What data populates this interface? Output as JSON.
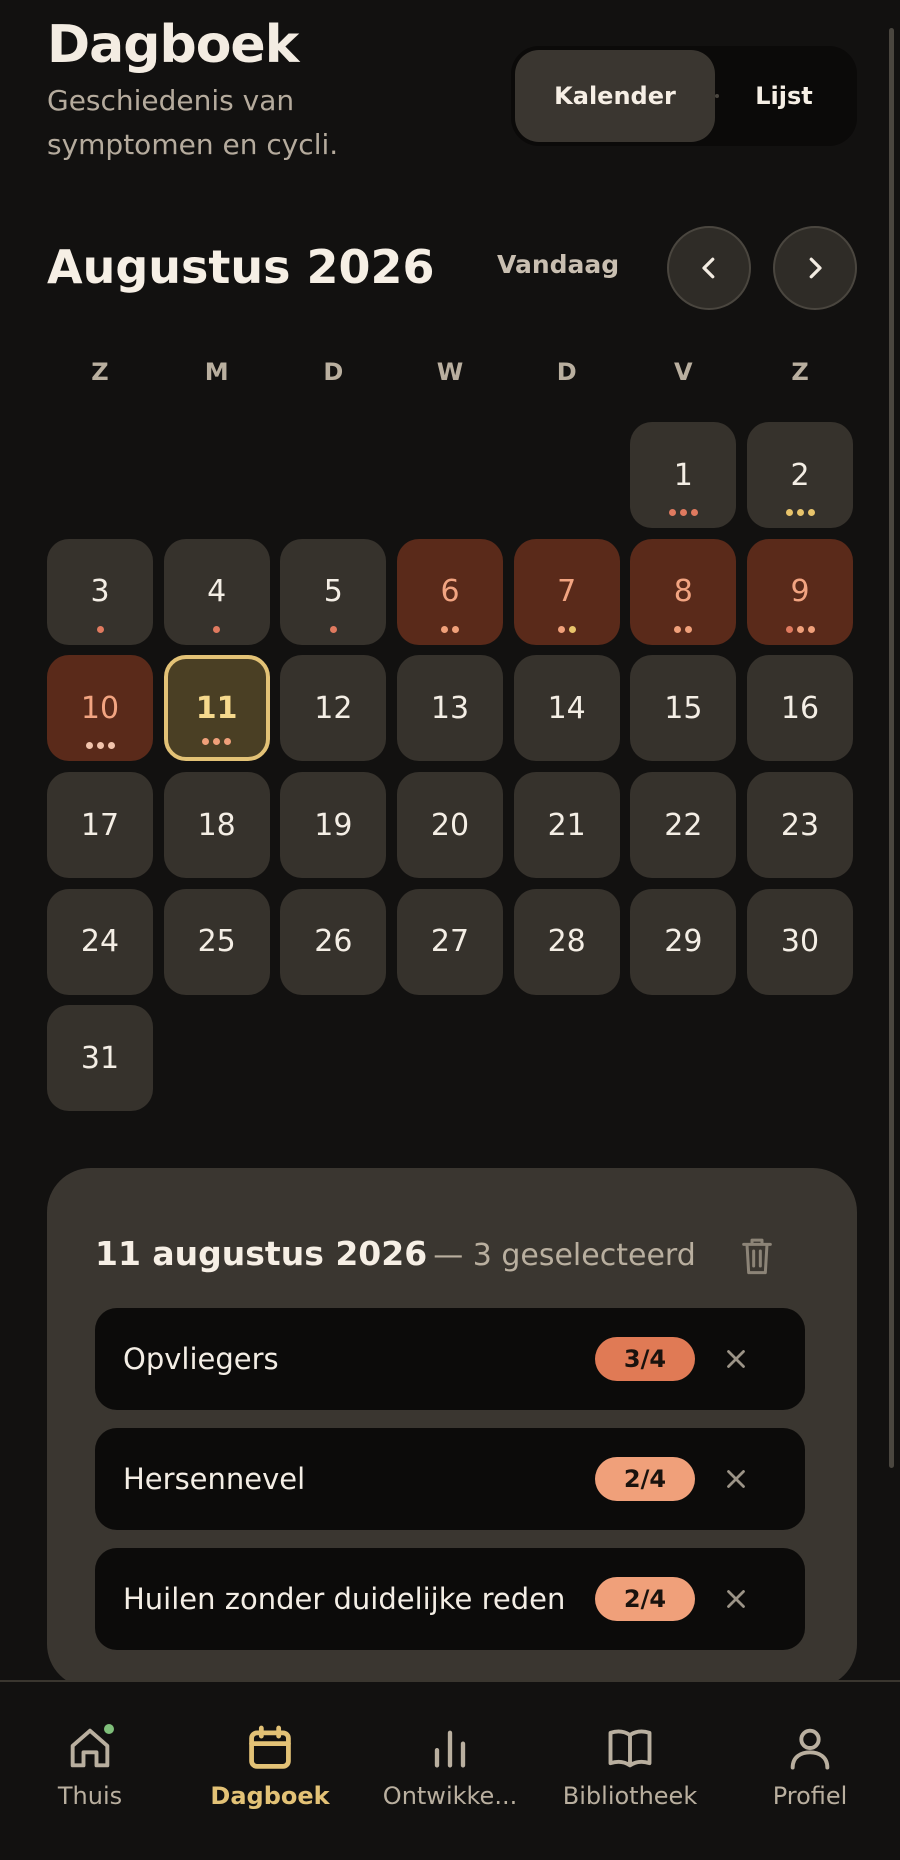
{
  "header": {
    "title": "Dagboek",
    "subtitle": "Geschiedenis van symptomen en cycli.",
    "view_toggle": {
      "calendar": "Kalender",
      "list": "Lijst",
      "active": "calendar"
    }
  },
  "calendar": {
    "month_title": "Augustus 2026",
    "today_label": "Vandaag",
    "weekdays": [
      "Z",
      "M",
      "D",
      "W",
      "D",
      "V",
      "Z"
    ],
    "first_weekday_index": 5,
    "days": [
      {
        "day": 1,
        "type": "normal",
        "dots": [
          "#e07a5f",
          "#e07a5f",
          "#e07a5f"
        ]
      },
      {
        "day": 2,
        "type": "normal",
        "dots": [
          "#e8c46b",
          "#e8c46b",
          "#e8c46b"
        ]
      },
      {
        "day": 3,
        "type": "normal",
        "dots": [
          "#e07a5f"
        ]
      },
      {
        "day": 4,
        "type": "normal",
        "dots": [
          "#e07a5f"
        ]
      },
      {
        "day": 5,
        "type": "normal",
        "dots": [
          "#e07a5f"
        ]
      },
      {
        "day": 6,
        "type": "period",
        "dots": [
          "#f0a07a",
          "#f0a07a"
        ]
      },
      {
        "day": 7,
        "type": "period",
        "dots": [
          "#f0a07a",
          "#e8c46b"
        ]
      },
      {
        "day": 8,
        "type": "period",
        "dots": [
          "#f0a07a",
          "#f0a07a"
        ]
      },
      {
        "day": 9,
        "type": "period",
        "dots": [
          "#e07a5f",
          "#f0a07a",
          "#f0a07a"
        ]
      },
      {
        "day": 10,
        "type": "period",
        "dots": [
          "#f2c4ad",
          "#f2c4ad",
          "#f2c4ad"
        ]
      },
      {
        "day": 11,
        "type": "selected",
        "dots": [
          "#f0a07a",
          "#f0a07a",
          "#f0a07a"
        ]
      },
      {
        "day": 12,
        "type": "normal",
        "dots": []
      },
      {
        "day": 13,
        "type": "normal",
        "dots": []
      },
      {
        "day": 14,
        "type": "normal",
        "dots": []
      },
      {
        "day": 15,
        "type": "normal",
        "dots": []
      },
      {
        "day": 16,
        "type": "normal",
        "dots": []
      },
      {
        "day": 17,
        "type": "normal",
        "dots": []
      },
      {
        "day": 18,
        "type": "normal",
        "dots": []
      },
      {
        "day": 19,
        "type": "normal",
        "dots": []
      },
      {
        "day": 20,
        "type": "normal",
        "dots": []
      },
      {
        "day": 21,
        "type": "normal",
        "dots": []
      },
      {
        "day": 22,
        "type": "normal",
        "dots": []
      },
      {
        "day": 23,
        "type": "normal",
        "dots": []
      },
      {
        "day": 24,
        "type": "normal",
        "dots": []
      },
      {
        "day": 25,
        "type": "normal",
        "dots": []
      },
      {
        "day": 26,
        "type": "normal",
        "dots": []
      },
      {
        "day": 27,
        "type": "normal",
        "dots": []
      },
      {
        "day": 28,
        "type": "normal",
        "dots": []
      },
      {
        "day": 29,
        "type": "normal",
        "dots": []
      },
      {
        "day": 30,
        "type": "normal",
        "dots": []
      },
      {
        "day": 31,
        "type": "normal",
        "dots": []
      }
    ]
  },
  "selected_day": {
    "date": "11 augustus 2026",
    "count_text": "— 3 geselecteerd",
    "symptoms": [
      {
        "name": "Opvliegers",
        "severity": "3/4",
        "color": "#e07a55"
      },
      {
        "name": "Hersennevel",
        "severity": "2/4",
        "color": "#f0a07a"
      },
      {
        "name": "Huilen zonder duidelijke reden",
        "severity": "2/4",
        "color": "#f0a07a"
      }
    ]
  },
  "bottom_nav": {
    "items": [
      {
        "label": "Thuis",
        "icon": "home-icon",
        "active": false,
        "badge": true
      },
      {
        "label": "Dagboek",
        "icon": "calendar-icon",
        "active": true,
        "badge": false
      },
      {
        "label": "Ontwikke...",
        "icon": "bar-chart-icon",
        "active": false,
        "badge": false
      },
      {
        "label": "Bibliotheek",
        "icon": "book-icon",
        "active": false,
        "badge": false
      },
      {
        "label": "Profiel",
        "icon": "user-icon",
        "active": false,
        "badge": false
      }
    ]
  },
  "colors": {
    "accent": "#e3c276",
    "background": "#121110",
    "period": "#5a2a1a",
    "status_dot": "#7fbf7a"
  }
}
